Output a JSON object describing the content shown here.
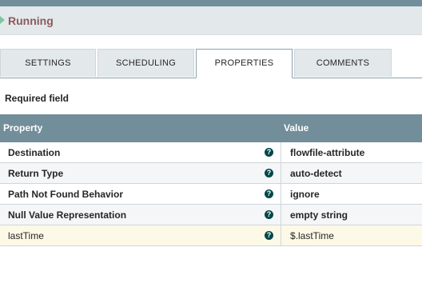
{
  "status": {
    "label": "Running"
  },
  "tabs": [
    {
      "label": "SETTINGS"
    },
    {
      "label": "SCHEDULING"
    },
    {
      "label": "PROPERTIES",
      "active": true
    },
    {
      "label": "COMMENTS"
    }
  ],
  "required_note": "Required field",
  "table": {
    "headers": {
      "property": "Property",
      "value": "Value"
    },
    "rows": [
      {
        "name": "Destination",
        "value": "flowfile-attribute",
        "help_icon": "?"
      },
      {
        "name": "Return Type",
        "value": "auto-detect",
        "help_icon": "?"
      },
      {
        "name": "Path Not Found Behavior",
        "value": "ignore",
        "help_icon": "?"
      },
      {
        "name": "Null Value Representation",
        "value": "empty string",
        "help_icon": "?"
      },
      {
        "name": "lastTime",
        "value": "$.lastTime",
        "help_icon": "?"
      }
    ]
  },
  "colors": {
    "header_bg": "#728e9b",
    "status_running": "#7dc7a0",
    "help_icon": "#004849"
  }
}
